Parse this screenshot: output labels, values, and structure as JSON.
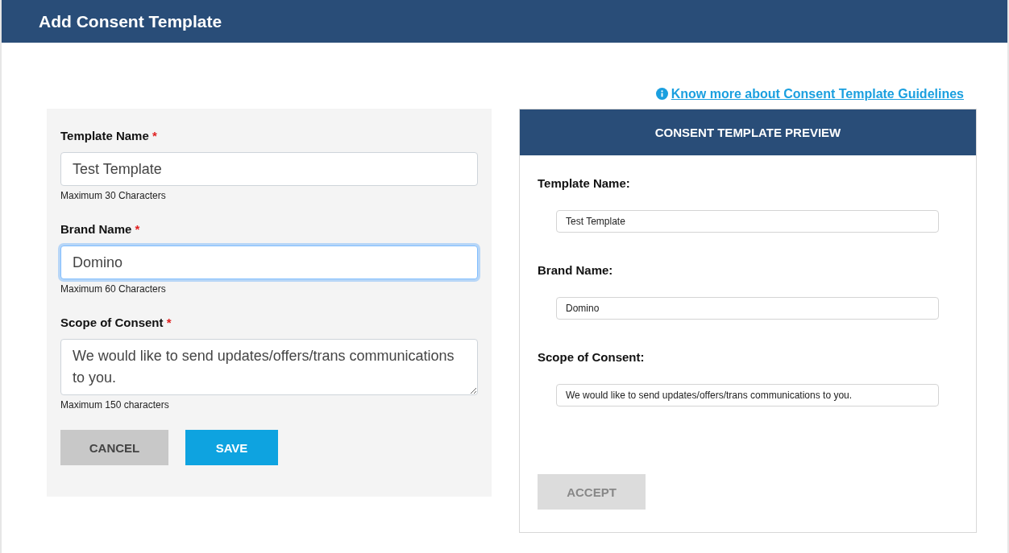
{
  "header": {
    "title": "Add Consent Template"
  },
  "guidelines_link": {
    "label": "Know more about Consent Template Guidelines"
  },
  "form": {
    "fields": [
      {
        "kind": "input",
        "label": "Template Name",
        "required_mark": "*",
        "value": "Test Template",
        "hint": "Maximum 30 Characters",
        "focused": false
      },
      {
        "kind": "input",
        "label": "Brand Name",
        "required_mark": "*",
        "value": "Domino",
        "hint": "Maximum 60 Characters",
        "focused": true
      },
      {
        "kind": "textarea",
        "label": "Scope of Consent",
        "required_mark": "*",
        "value": "We would like to send updates/offers/trans communications to you.",
        "hint": "Maximum 150 characters",
        "focused": false
      }
    ],
    "buttons": [
      {
        "kind": "secondary",
        "label": "CANCEL"
      },
      {
        "kind": "primary",
        "label": "SAVE"
      }
    ]
  },
  "preview": {
    "title": "CONSENT TEMPLATE PREVIEW",
    "fields": [
      {
        "label": "Template Name:",
        "value": "Test Template"
      },
      {
        "label": "Brand Name:",
        "value": "Domino"
      },
      {
        "label": "Scope of Consent:",
        "value": "We would like to send updates/offers/trans communications to you."
      }
    ],
    "accept_button": {
      "label": "ACCEPT",
      "disabled": true
    }
  }
}
